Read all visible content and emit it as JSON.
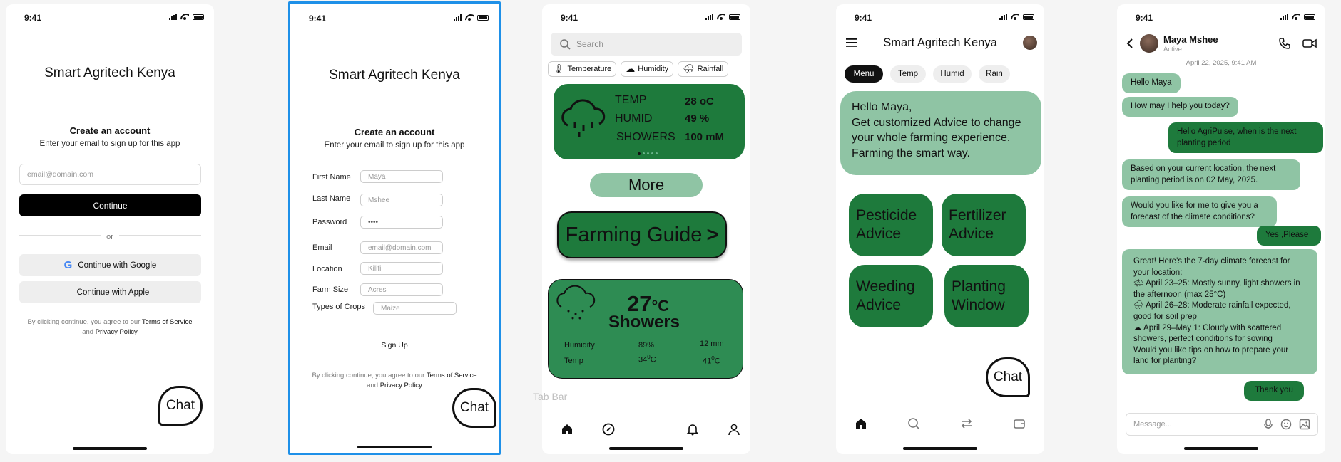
{
  "common": {
    "time": "9:41",
    "chat_label": "Chat",
    "app_title": "Smart Agritech Kenya"
  },
  "screen1": {
    "heading": "Create an account",
    "subheading": "Enter your email to sign up for this app",
    "email_placeholder": "email@domain.com",
    "continue_label": "Continue",
    "or_label": "or",
    "google_label": "Continue with Google",
    "apple_label": "Continue with Apple",
    "legal_prefix": "By clicking continue, you agree to our",
    "terms": "Terms of Service",
    "and": "and",
    "privacy": "Privacy Policy"
  },
  "screen2": {
    "heading": "Create an account",
    "subheading": "Enter your email to sign up for this app",
    "fields": [
      {
        "label": "First Name",
        "placeholder": "Maya"
      },
      {
        "label": "Last Name",
        "placeholder": "Mshee"
      },
      {
        "label": "Password",
        "placeholder": "••••"
      },
      {
        "label": "Email",
        "placeholder": "email@domain.com"
      },
      {
        "label": "Location",
        "placeholder": "Kilifi"
      },
      {
        "label": "Farm Size",
        "placeholder": "Acres"
      },
      {
        "label": "Types of Crops",
        "placeholder": "Maize"
      }
    ],
    "signup_label": "Sign Up",
    "legal_prefix": "By clicking continue, you agree to our",
    "terms": "Terms of Service",
    "and": "and",
    "privacy": "Privacy Policy"
  },
  "screen3": {
    "search_placeholder": "Search",
    "chips": [
      "Temperature",
      "Humidity",
      "Rainfall"
    ],
    "card": {
      "rows": [
        {
          "label": "TEMP",
          "value": "28 oC"
        },
        {
          "label": "HUMID",
          "value": "49 %"
        },
        {
          "label": "SHOWERS",
          "value": "100 mM"
        }
      ]
    },
    "more_label": "More",
    "guide_label": "Farming Guide",
    "guide_arrow": ">",
    "weather": {
      "temp": "27",
      "temp_unit": "°C",
      "condition": "Showers",
      "rain": "12 mm",
      "humidity_label": "Humidity",
      "humidity_value": "89%",
      "temp_label": "Temp",
      "temp_low": "34",
      "temp_high": "41",
      "deg": "0",
      "c": "C"
    },
    "tab_bar_label": "Tab Bar"
  },
  "screen4": {
    "title": "Smart Agritech Kenya",
    "pills": [
      "Menu",
      "Temp",
      "Humid",
      "Rain"
    ],
    "greeting_line1": "Hello Maya,",
    "greeting_body": "Get customized Advice to change your whole farming experience. Farming the smart way.",
    "tiles": [
      [
        "Pesticide",
        "Advice"
      ],
      [
        "Fertilizer",
        "Advice"
      ],
      [
        "Weeding",
        "Advice"
      ],
      [
        "Planting",
        "Window"
      ]
    ]
  },
  "screen5": {
    "contact_name": "Maya Mshee",
    "contact_status": "Active",
    "date": "April 22, 2025, 9:41 AM",
    "messages": [
      {
        "from": "in",
        "text": "Hello Maya"
      },
      {
        "from": "in",
        "text": "How may I help you today?"
      },
      {
        "from": "out",
        "text": "Hello AgriPulse, when is the next planting period"
      },
      {
        "from": "in",
        "text": "Based on your current location, the next planting period is on 02 May, 2025."
      },
      {
        "from": "in",
        "text": "Would you like for me to give you a forecast of the climate conditions?"
      },
      {
        "from": "out",
        "text": "Yes ,Please"
      },
      {
        "from": "in",
        "text": "Great! Here's the 7-day climate forecast for your location:\n🌤 April 23–25: Mostly sunny, light showers in the afternoon (max 25°C)\n🌧 April 26–28: Moderate rainfall expected, good for soil prep\n☁ April 29–May 1: Cloudy with scattered showers, perfect conditions for sowing\nWould you like tips on how to prepare your land for planting?"
      },
      {
        "from": "out",
        "text": "Thank you"
      }
    ],
    "message_placeholder": "Message..."
  }
}
